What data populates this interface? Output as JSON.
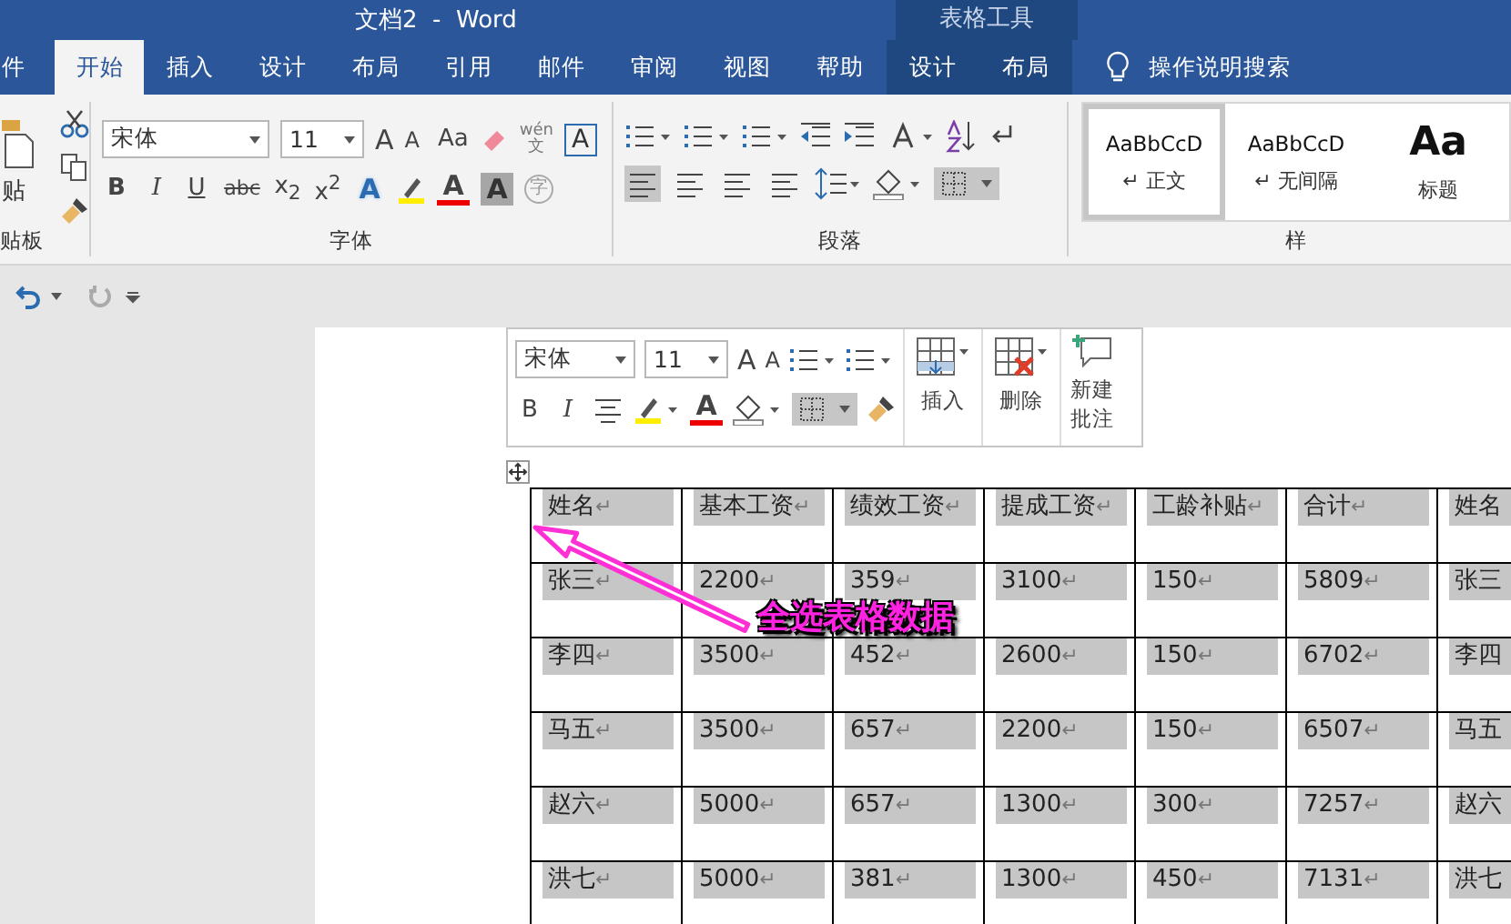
{
  "window": {
    "title": "文档2  -  Word",
    "context_title": "表格工具"
  },
  "tabs": [
    {
      "label": "件",
      "selected": false,
      "context": false
    },
    {
      "label": "开始",
      "selected": true,
      "context": false
    },
    {
      "label": "插入",
      "selected": false,
      "context": false
    },
    {
      "label": "设计",
      "selected": false,
      "context": false
    },
    {
      "label": "布局",
      "selected": false,
      "context": false
    },
    {
      "label": "引用",
      "selected": false,
      "context": false
    },
    {
      "label": "邮件",
      "selected": false,
      "context": false
    },
    {
      "label": "审阅",
      "selected": false,
      "context": false
    },
    {
      "label": "视图",
      "selected": false,
      "context": false
    },
    {
      "label": "帮助",
      "selected": false,
      "context": false
    },
    {
      "label": "设计",
      "selected": false,
      "context": true
    },
    {
      "label": "布局",
      "selected": false,
      "context": true
    }
  ],
  "tell_me": "操作说明搜索",
  "ribbon": {
    "clipboard": {
      "paste_label": "贴",
      "group_label": "贴板"
    },
    "font": {
      "name": "宋体",
      "size": "11",
      "grow": "A",
      "shrink": "A",
      "case_button": "Aa",
      "pinyin_top": "wén",
      "pinyin_bottom": "文",
      "bordered_char": "A",
      "format_buttons": [
        "B",
        "I",
        "U",
        "abc",
        "x$_{2}$",
        "x$^{2}$"
      ],
      "effect_glyphs": [
        "A",
        "A",
        "A"
      ],
      "enclose_char": "字",
      "group_label": "字体"
    },
    "paragraph": {
      "group_label": "段落"
    },
    "styles": {
      "items": [
        {
          "preview": "AaBbCcD",
          "label": "↵ 正文",
          "selected": true,
          "kind": "normal"
        },
        {
          "preview": "AaBbCcD",
          "label": "↵ 无间隔",
          "selected": false,
          "kind": "normal"
        },
        {
          "preview": "Aa",
          "label": "标题",
          "selected": false,
          "kind": "heading"
        }
      ],
      "group_label": "样"
    }
  },
  "mini_toolbar": {
    "font": "宋体",
    "size": "11",
    "grow": "A",
    "shrink": "A",
    "bold": "B",
    "italic": "I",
    "font_color": "A",
    "insert": "插入",
    "delete": "删除",
    "comment": "新建批注"
  },
  "paragraph_mark": "↵",
  "table": {
    "selected": true,
    "columns": [
      "姓名",
      "基本工资",
      "绩效工资",
      "提成工资",
      "工龄补贴",
      "合计",
      "姓名"
    ],
    "rows": [
      [
        "张三",
        "2200",
        "359",
        "3100",
        "150",
        "5809",
        "张三"
      ],
      [
        "李四",
        "3500",
        "452",
        "2600",
        "150",
        "6702",
        "李四"
      ],
      [
        "马五",
        "3500",
        "657",
        "2200",
        "150",
        "6507",
        "马五"
      ],
      [
        "赵六",
        "5000",
        "657",
        "1300",
        "300",
        "7257",
        "赵六"
      ],
      [
        "洪七",
        "5000",
        "381",
        "1300",
        "450",
        "7131",
        "洪七"
      ]
    ]
  },
  "annotation": {
    "text": "全选表格数据"
  }
}
